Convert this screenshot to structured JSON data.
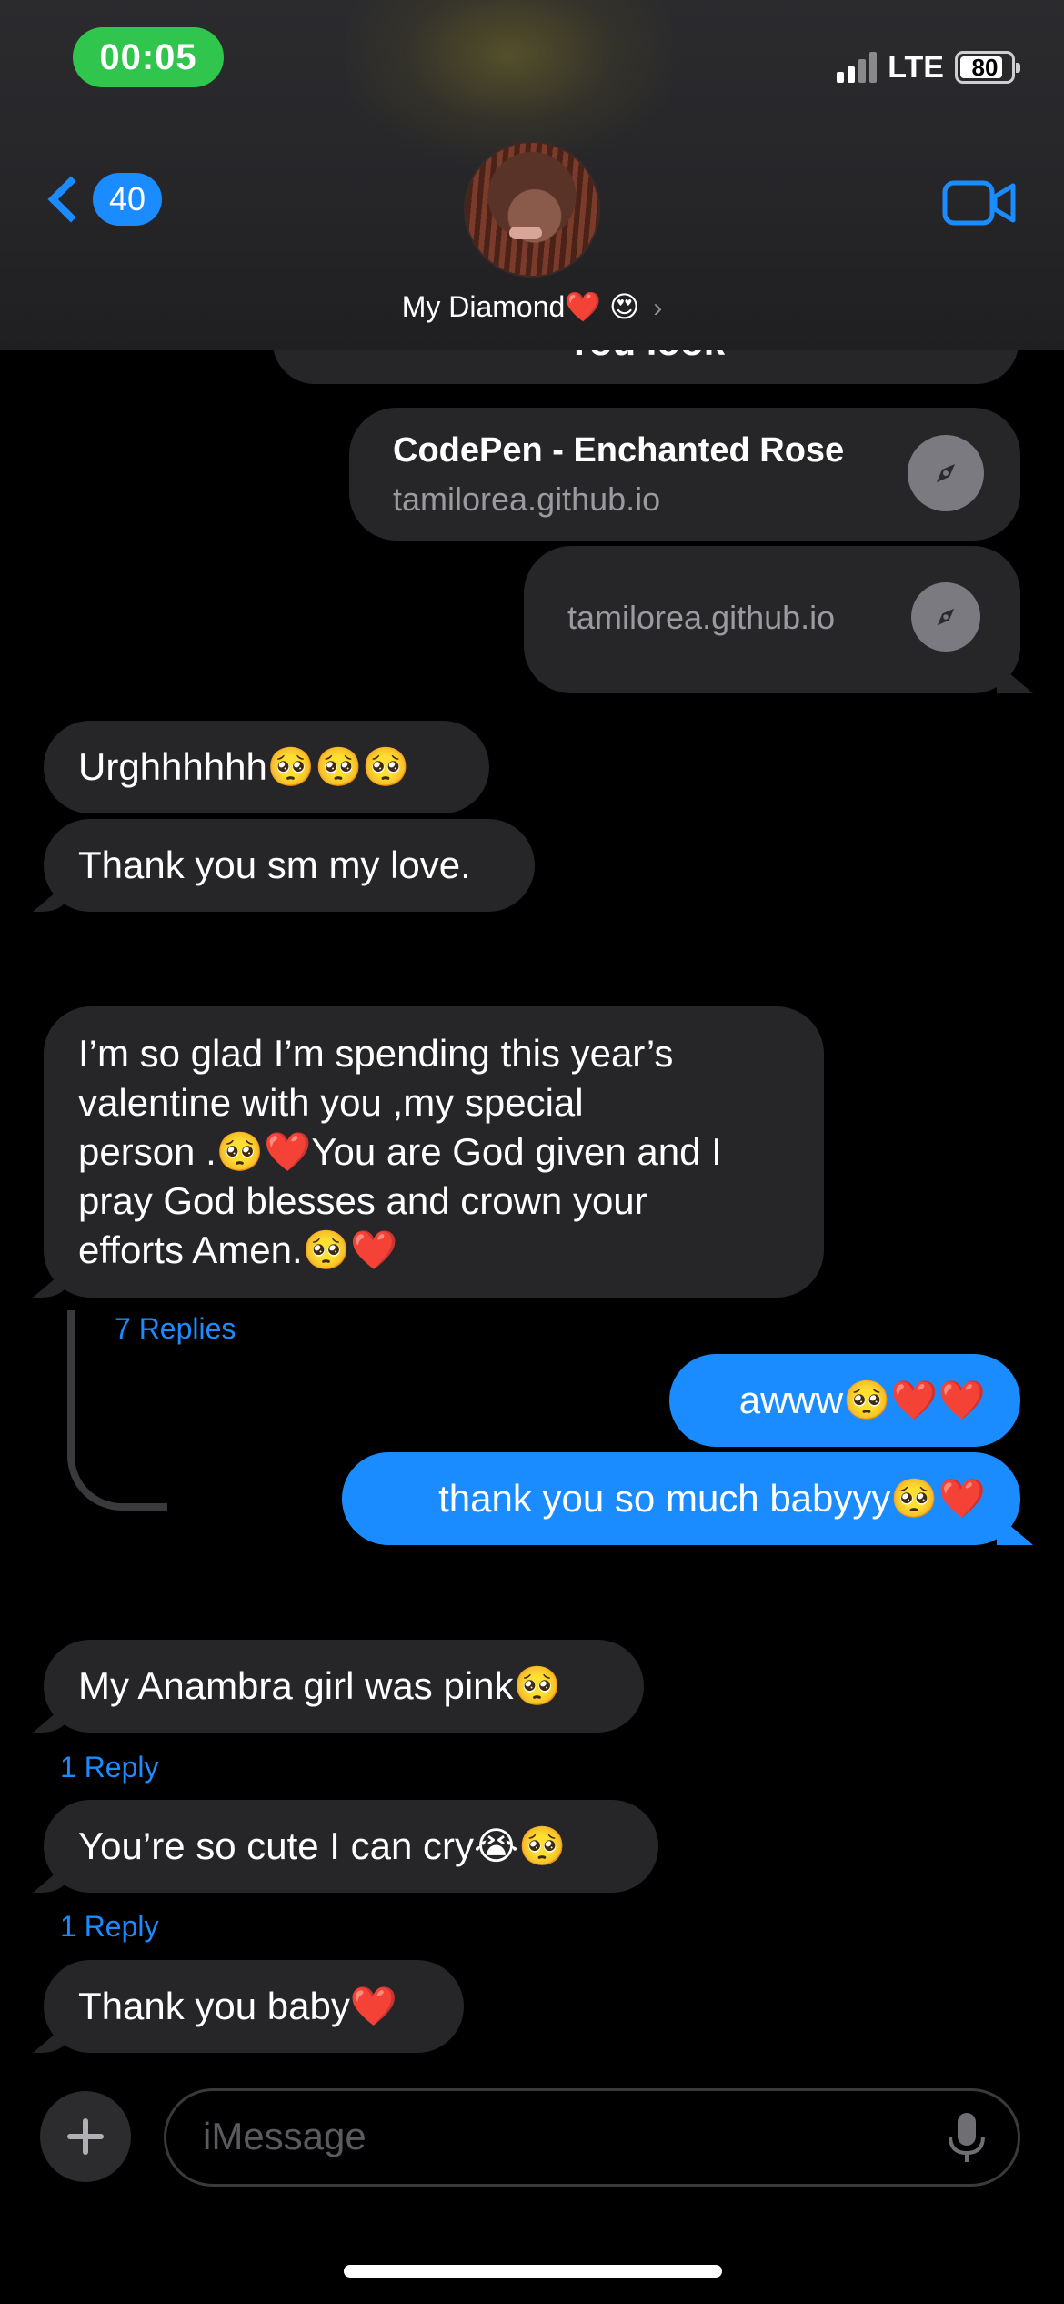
{
  "status_bar": {
    "time": "00:05",
    "network": "LTE",
    "battery": "80"
  },
  "header": {
    "back_count": "40",
    "contact_name": "My Diamond",
    "contact_emoji_heart": "❤️",
    "contact_emoji_face": "😍"
  },
  "top_cut_text": "You look",
  "link_preview": {
    "title": "CodePen - Enchanted Rose",
    "domain": "tamilorea.github.io"
  },
  "link_bubble": {
    "domain": "tamilorea.github.io"
  },
  "messages": {
    "m1": "Urghhhhhh🥺🥺🥺",
    "m2": "Thank you sm my love.",
    "m3_l1": "I’m so glad I’m spending this year’s",
    "m3_l2": "valentine with you ,my special",
    "m3_l3": "person .🥺❤️You are God given and I",
    "m3_l4": "pray God blesses and crown your",
    "m3_l5": "efforts Amen.🥺❤️",
    "m3_replies": "7 Replies",
    "s1": "awww🥺❤️❤️",
    "s2": "thank you so much babyyy🥺❤️",
    "m4": "My Anambra girl was pink🥺",
    "m4_replies": "1 Reply",
    "m5": "You’re so cute I can cry😭🥺",
    "m5_replies": "1 Reply",
    "m6": "Thank you baby❤️"
  },
  "input": {
    "placeholder": "iMessage"
  },
  "colors": {
    "sent_bubble": "#1a8cff",
    "received_bubble": "#262628",
    "time_pill": "#30c64d",
    "link_blue": "#1a8cff"
  }
}
